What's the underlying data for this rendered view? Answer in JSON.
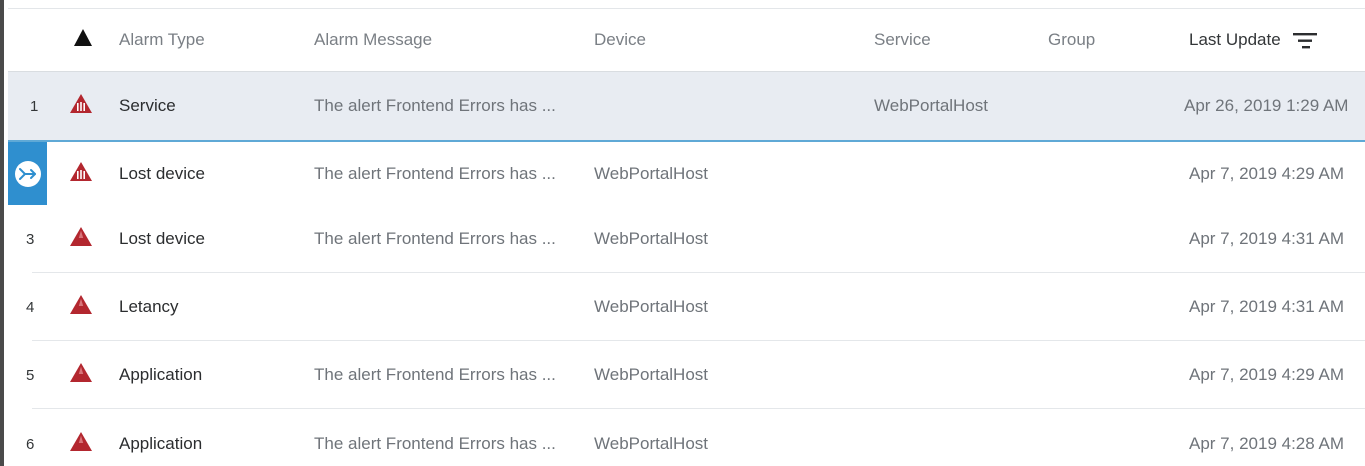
{
  "table": {
    "columns": {
      "severity_icon": "severity-warning-icon",
      "alarm_type": "Alarm Type",
      "alarm_message": "Alarm Message",
      "device": "Device",
      "service": "Service",
      "group": "Group",
      "last_update": "Last Update",
      "sort_icon": "sort-descending-icon"
    },
    "rows": [
      {
        "num": "1",
        "type": "Service",
        "message": "The alert Frontend Errors has ...",
        "device": "",
        "service": "WebPortalHost",
        "group": "",
        "time": "Apr 26, 2019 1:29 AM",
        "state": "hovered"
      },
      {
        "num": "",
        "type": "Lost device",
        "message": "The alert Frontend Errors has ...",
        "device": "WebPortalHost",
        "service": "",
        "group": "",
        "time": "Apr 7, 2019 4:29 AM",
        "state": "selected",
        "select_icon": "route-arrow-icon"
      },
      {
        "num": "3",
        "type": "Lost device",
        "message": "The alert Frontend Errors has ...",
        "device": "WebPortalHost",
        "service": "",
        "group": "",
        "time": "Apr 7, 2019 4:31 AM",
        "state": "normal"
      },
      {
        "num": "4",
        "type": "Letancy",
        "message": "",
        "device": "WebPortalHost",
        "service": "",
        "group": "",
        "time": "Apr 7, 2019 4:31 AM",
        "state": "normal"
      },
      {
        "num": "5",
        "type": "Application",
        "message": "The alert Frontend Errors has ...",
        "device": "WebPortalHost",
        "service": "",
        "group": "",
        "time": "Apr 7, 2019 4:29 AM",
        "state": "normal"
      },
      {
        "num": "6",
        "type": "Application",
        "message": "The alert Frontend Errors has ...",
        "device": "WebPortalHost",
        "service": "",
        "group": "",
        "time": "Apr 7, 2019 4:28 AM",
        "state": "normal"
      }
    ]
  },
  "colors": {
    "alarm_icon": "#b3272f",
    "selection_accent": "#2f8fcf",
    "hover_row": "#e8ecf2"
  }
}
